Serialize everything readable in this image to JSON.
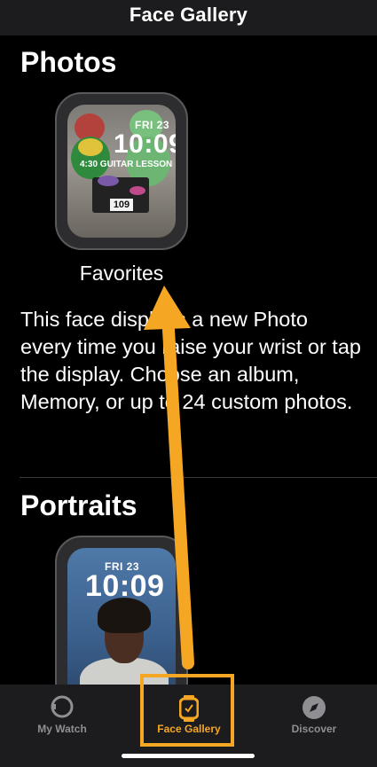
{
  "header": {
    "title": "Face Gallery"
  },
  "photos_section": {
    "title": "Photos",
    "face_name": "Favorites",
    "watch_date": "FRI 23",
    "watch_time": "10:09",
    "watch_event": "4:30 GUITAR LESSON",
    "box_number": "109",
    "description": "This face displays a new Photo every time you raise your wrist or tap the display. Choose an album, Memory, or up to 24 custom photos."
  },
  "portraits_section": {
    "title": "Portraits",
    "watch_date": "FRI 23",
    "watch_time": "10:09"
  },
  "tab_bar": {
    "items": [
      {
        "label": "My Watch",
        "icon": "watch-outline-icon",
        "selected": false
      },
      {
        "label": "Face Gallery",
        "icon": "watch-face-icon",
        "selected": true
      },
      {
        "label": "Discover",
        "icon": "compass-icon",
        "selected": false
      }
    ]
  },
  "colors": {
    "accent": "#f5a623",
    "background": "#000000",
    "bar": "#1c1c1e",
    "inactive": "#8e8e93"
  }
}
